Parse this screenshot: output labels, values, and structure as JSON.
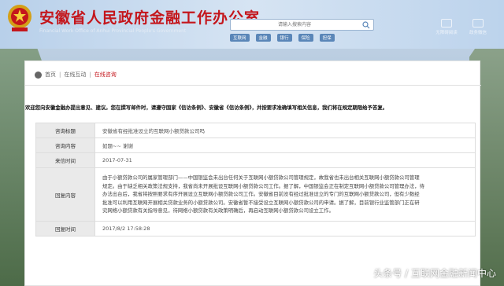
{
  "header": {
    "title": "安徽省人民政府金融工作办公室",
    "subtitle": "Financial Work Office of Anhui Provincial People's Government",
    "search_placeholder": "请输入搜索内容",
    "quick_links": [
      "互联网",
      "金融",
      "银行",
      "保险",
      "担保"
    ],
    "top_icons": [
      {
        "label": "无障碍阅读",
        "icon": "accessibility-icon"
      },
      {
        "label": "政务微信",
        "icon": "wechat-icon"
      }
    ]
  },
  "breadcrumb": {
    "home": "首页",
    "section": "在线互动",
    "current": "在线咨询"
  },
  "notice": "欢迎您向安徽金融办提出意见、建议。您在撰写邮件时，请遵守国家《信访条例》、安徽省《信访条例》，并按要求准确填写相关信息，我们将在规定期限给予答复。",
  "qa": {
    "title_label": "咨询标题",
    "title_value": "安徽省有经批准设立的互联网小额贷款公司吗",
    "content_label": "咨询内容",
    "content_value": "如题~~ 谢谢",
    "date_label": "来信时间",
    "date_value": "2017-07-31",
    "reply_label": "回复内容",
    "reply_lines": [
      "由于小额贷款公司的属家管理部门——中国银监会未出台任何关于互联网小额贷款公司管理规定，故我省也未出台相关互联网小额贷款公司管理",
      "规定。由于缺乏相关政策法规支持，我省尚未开展批设互联网小额贷款公司工作。据了解，中国银监会正在制定互联网小额贷款公司管理办法，待",
      "办法出台后，我省将按照要求有序开展设立互联网小额贷款公司工作。安徽省目前没有经过批准设立的专门的互联网小额贷款公司，但有少数经",
      "批准可以利用互联网开展相关贷款业务的小额贷款公司。安徽省暂不接受设立互联网小额贷款公司的申请。据了解，目前银行业监管部门正在研",
      "究网络小额贷款有关指导意见，待网络小额贷款有关政策明确后，再启动互联网小额贷款公司设立工作。"
    ],
    "reply_time_label": "回复时间",
    "reply_time_value": "2017/8/2 17:58:28"
  },
  "watermark": "头条号 / 互联网金融新闻中心",
  "colors": {
    "title_red": "#c4161c",
    "label_bg": "#eaeaea",
    "breadcrumb_active": "#c4161c"
  }
}
